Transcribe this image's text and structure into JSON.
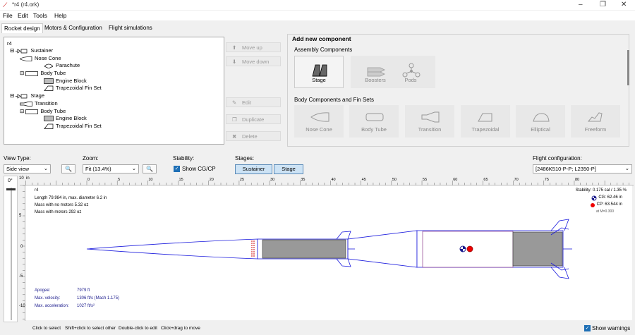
{
  "window": {
    "title": "*r4 (r4.ork)"
  },
  "menu": [
    "File",
    "Edit",
    "Tools",
    "Help"
  ],
  "tabs": [
    "Rocket design",
    "Motors & Configuration",
    "Flight simulations"
  ],
  "tree": {
    "root": "r4",
    "items": [
      "Sustainer",
      "Nose Cone",
      "Parachute",
      "Body Tube",
      "Engine Block",
      "Trapezoidal Fin Set",
      "Stage",
      "Transition",
      "Body Tube",
      "Engine Block",
      "Trapezoidal Fin Set"
    ]
  },
  "actions": {
    "move_up": "Move up",
    "move_down": "Move down",
    "edit": "Edit",
    "duplicate": "Duplicate",
    "delete": "Delete"
  },
  "add_panel": {
    "title": "Add new component",
    "assembly_title": "Assembly Components",
    "assembly": [
      "Stage",
      "Boosters",
      "Pods"
    ],
    "body_title": "Body Components and Fin Sets",
    "body": [
      "Nose Cone",
      "Body Tube",
      "Transition",
      "Trapezoidal",
      "Elliptical",
      "Freeform"
    ]
  },
  "controls": {
    "view_type_label": "View Type:",
    "view_type_value": "Side view",
    "zoom_label": "Zoom:",
    "zoom_value": "Fit (13.4%)",
    "stability_label": "Stability:",
    "show_cgcp": "Show CG/CP",
    "stages_label": "Stages:",
    "stages": [
      "Sustainer",
      "Stage"
    ],
    "flight_config_label": "Flight configuration:",
    "flight_config_value": "[2486K510-P-P; L2350-P]",
    "rotation": "0°"
  },
  "figure": {
    "name": "r4",
    "length": "Length 79.984 in, max. diameter 6.2 in",
    "mass_no_motor": "Mass with no motors 5.32 oz",
    "mass_with_motor": "Mass with motors 292 oz",
    "stability": "Stability: 0.175 cal / 1.35 %",
    "cg": "CG:  62.46 in",
    "cp": "CP: 63.544 in",
    "aoa": "at M=0.300",
    "apogee_label": "Apogee:",
    "apogee_value": "7979 ft",
    "vel_label": "Max. velocity:",
    "vel_value": "1306 ft/s  (Mach 1.175)",
    "acc_label": "Max. acceleration:",
    "acc_value": "1027 ft/s²"
  },
  "ruler_top": [
    "0",
    "5",
    "10",
    "15",
    "20",
    "25",
    "30",
    "35",
    "40",
    "45",
    "50",
    "55",
    "60",
    "65",
    "70",
    "75",
    "80"
  ],
  "ruler_left": [
    "10",
    "5",
    "0",
    "-5",
    "-10"
  ],
  "ruler_unit": "in",
  "status": {
    "hints": [
      "Click to select",
      "Shift+click to select other",
      "Double-click to edit",
      "Click+drag to move"
    ],
    "show_warnings": "Show warnings"
  }
}
